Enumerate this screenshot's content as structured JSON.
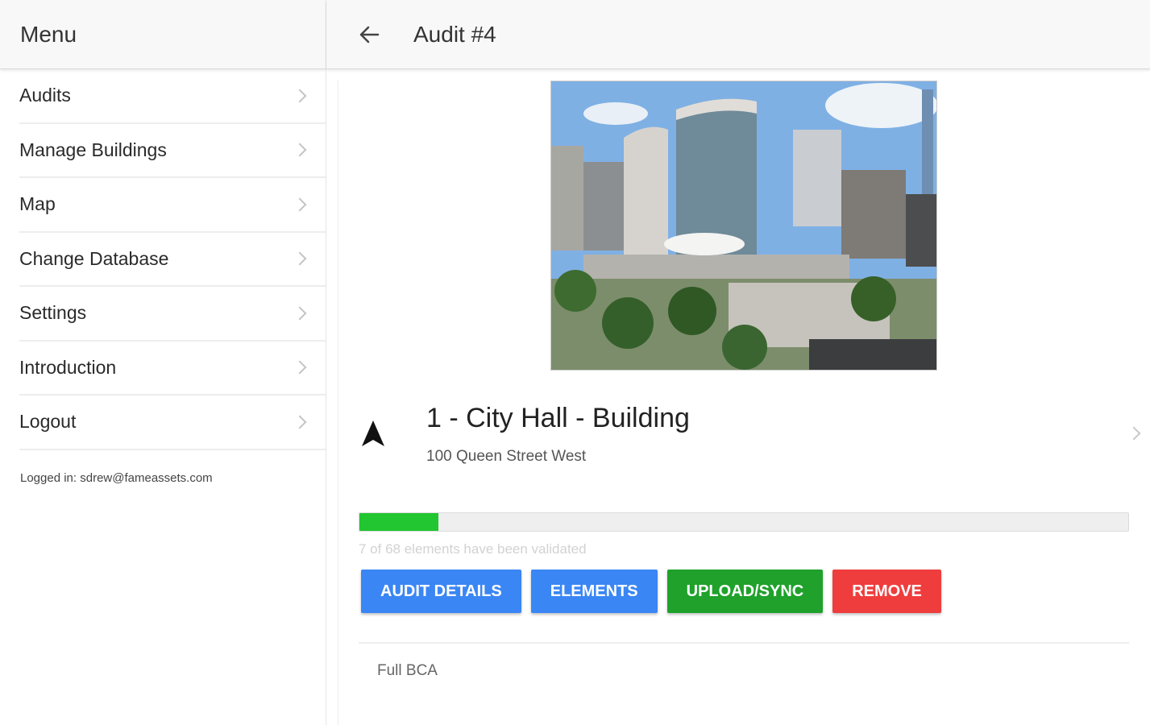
{
  "sidebar": {
    "title": "Menu",
    "items": [
      {
        "label": "Audits"
      },
      {
        "label": "Manage Buildings"
      },
      {
        "label": "Map"
      },
      {
        "label": "Change Database"
      },
      {
        "label": "Settings"
      },
      {
        "label": "Introduction"
      },
      {
        "label": "Logout"
      }
    ],
    "logged_in": "Logged in: sdrew@fameassets.com"
  },
  "header": {
    "title": "Audit #4",
    "back_icon": "arrow-left-icon"
  },
  "building": {
    "image_icon": "building-photo",
    "name": "1 - City Hall - Building",
    "address": "100 Queen Street West",
    "nav_icon": "navigation-arrow-icon"
  },
  "progress": {
    "validated": 7,
    "total": 68,
    "fraction": 0.103,
    "text": "7 of 68 elements have been validated",
    "color": "#21c631"
  },
  "actions": {
    "audit_details": "AUDIT DETAILS",
    "elements": "ELEMENTS",
    "upload_sync": "UPLOAD/SYNC",
    "remove": "REMOVE"
  },
  "colors": {
    "blue": "#3a86f4",
    "green": "#1fa12b",
    "red": "#ef3d3d"
  },
  "audit_type": "Full BCA"
}
